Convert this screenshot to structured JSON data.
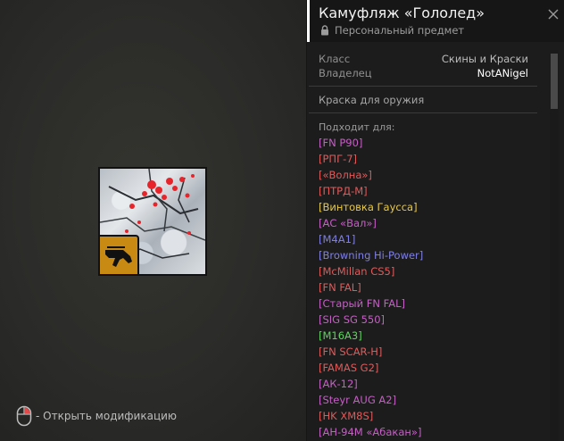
{
  "hint": {
    "icon": "mouse-icon",
    "text": "- Открыть модификацию"
  },
  "skin": {
    "badge_icon": "rifle-icon",
    "badge_color": "#c98a14"
  },
  "panel": {
    "title": "Камуфляж «Гололед»",
    "subtitle": "Персональный предмет",
    "subtitle_icon": "lock-icon",
    "info": {
      "class_label": "Класс",
      "class_value": "Скины и Краски",
      "owner_label": "Владелец",
      "owner_value": "NotANigel"
    },
    "type": "Краска для оружия",
    "fits_label": "Подходит для:",
    "fits": [
      {
        "name": "[FN P90]",
        "color": "#c65fc6"
      },
      {
        "name": "[РПГ-7]",
        "color": "#e05a5a"
      },
      {
        "name": "[«Волна»]",
        "color": "#e05a5a"
      },
      {
        "name": "[ПТРД-М]",
        "color": "#e05a5a"
      },
      {
        "name": "[Винтовка Гаусса]",
        "color": "#e6c84a"
      },
      {
        "name": "[АС «Вал»]",
        "color": "#c65fc6"
      },
      {
        "name": "[M4A1]",
        "color": "#7f7fe6"
      },
      {
        "name": "[Browning Hi-Power]",
        "color": "#7f7fe6"
      },
      {
        "name": "[McMillan CS5]",
        "color": "#e05a5a"
      },
      {
        "name": "[FN FAL]",
        "color": "#e05a5a"
      },
      {
        "name": "[Старый FN FAL]",
        "color": "#c65fc6"
      },
      {
        "name": "[SIG SG 550]",
        "color": "#c65fc6"
      },
      {
        "name": "[M16A3]",
        "color": "#5ed45e"
      },
      {
        "name": "[FN SCAR-H]",
        "color": "#e05a5a"
      },
      {
        "name": "[FAMAS G2]",
        "color": "#e05a5a"
      },
      {
        "name": "[АК-12]",
        "color": "#c65fc6"
      },
      {
        "name": "[Steyr AUG A2]",
        "color": "#c65fc6"
      },
      {
        "name": "[HK XM8S]",
        "color": "#e05a5a"
      },
      {
        "name": "[АН-94М «Абакан»]",
        "color": "#c65fc6"
      }
    ]
  }
}
